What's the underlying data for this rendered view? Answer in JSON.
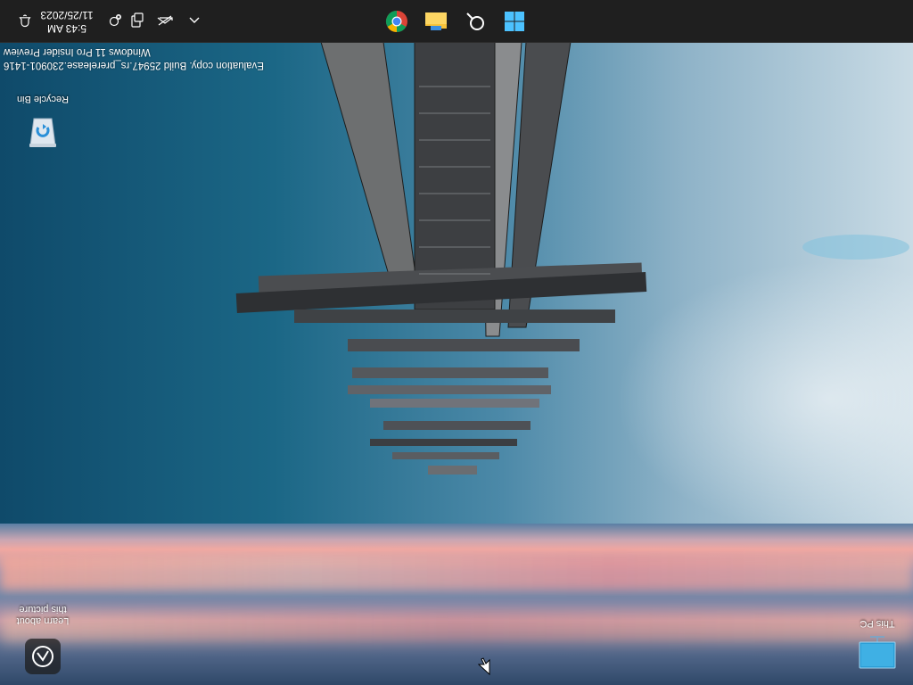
{
  "taskbar": {
    "clock": {
      "time": "5:43 AM",
      "date": "11/25/2023"
    },
    "tray_icons": [
      "notification-bell-icon",
      "location-off-icon",
      "volume-network-icon",
      "battery-display-icon",
      "show-hidden-chevron-icon"
    ],
    "pinned_apps": [
      {
        "name": "Google Chrome",
        "icon": "chrome-icon"
      },
      {
        "name": "File Explorer",
        "icon": "file-explorer-icon"
      },
      {
        "name": "Search",
        "icon": "search-icon"
      },
      {
        "name": "Start",
        "icon": "windows-start-icon"
      }
    ],
    "accent": "#1f1f1f"
  },
  "watermark": {
    "line1": "Windows 11 Pro Insider Preview",
    "line2": "Evaluation copy. Build 25947.rs_prerelease.230901-1416"
  },
  "desktop_icons": {
    "recycle_bin": "Recycle Bin",
    "learn_about": "Learn about this picture",
    "this_pc": "This PC"
  },
  "colors": {
    "sky_top": "#0f4a6a",
    "sky_light": "#c9dbe5",
    "sunset_pink": "#f0a8a2"
  }
}
